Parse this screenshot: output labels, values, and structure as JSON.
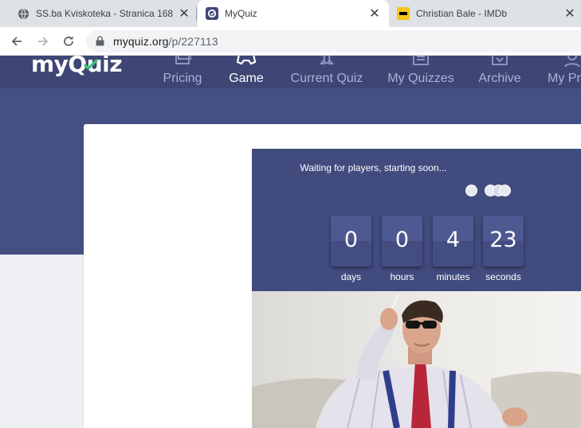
{
  "browser": {
    "tabs": [
      {
        "title": "SS.ba Kviskoteka - Stranica 168 -",
        "favicon": "globe-icon"
      },
      {
        "title": "MyQuiz",
        "favicon": "myquiz-icon",
        "active": true
      },
      {
        "title": "Christian Bale - IMDb",
        "favicon": "imdb-icon"
      }
    ],
    "address": {
      "domain": "myquiz.org",
      "path": "/p/227113"
    }
  },
  "site": {
    "logo_text": "myQuiz",
    "nav": [
      {
        "label": "Pricing",
        "icon": "pricing-icon"
      },
      {
        "label": "Game",
        "icon": "gamepad-icon",
        "active": true
      },
      {
        "label": "Current Quiz",
        "icon": "rocket-icon"
      },
      {
        "label": "My Quizzes",
        "icon": "folder-icon"
      },
      {
        "label": "Archive",
        "icon": "archive-icon"
      },
      {
        "label": "My Pro",
        "icon": "user-icon"
      }
    ]
  },
  "countdown": {
    "status": "Waiting for players, starting soon...",
    "units": [
      {
        "value": "0",
        "label": "days"
      },
      {
        "value": "0",
        "label": "hours"
      },
      {
        "value": "4",
        "label": "minutes"
      },
      {
        "value": "23",
        "label": "seconds"
      }
    ]
  },
  "colors": {
    "header": "#3d4675",
    "band": "#454f82",
    "panel": "#414b7e",
    "check": "#3fbf7f",
    "imdb": "#f5c518"
  }
}
